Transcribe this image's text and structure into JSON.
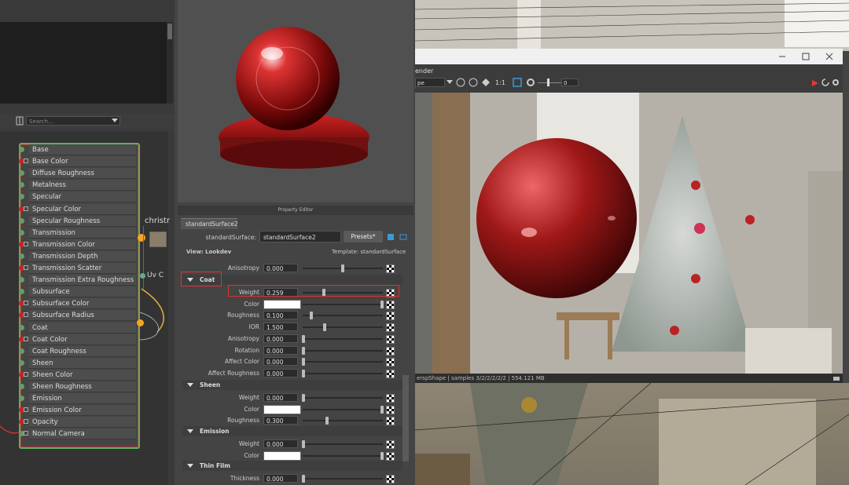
{
  "colors": {
    "accent_red": "#dd3333",
    "port_green": "#6a9a6a",
    "port_red": "#cc2222",
    "node_border": "#5fae5f",
    "orange": "#f5a623"
  },
  "node_editor": {
    "search_placeholder": "Search...",
    "attributes": [
      {
        "label": "Base",
        "port": "green",
        "expand": false
      },
      {
        "label": "Base Color",
        "port": "red",
        "expand": true
      },
      {
        "label": "Diffuse Roughness",
        "port": "green",
        "expand": false
      },
      {
        "label": "Metalness",
        "port": "green",
        "expand": false
      },
      {
        "label": "Specular",
        "port": "green",
        "expand": false
      },
      {
        "label": "Specular Color",
        "port": "red",
        "expand": true
      },
      {
        "label": "Specular Roughness",
        "port": "green",
        "expand": false
      },
      {
        "label": "Transmission",
        "port": "green",
        "expand": false
      },
      {
        "label": "Transmission Color",
        "port": "red",
        "expand": true
      },
      {
        "label": "Transmission Depth",
        "port": "green",
        "expand": false
      },
      {
        "label": "Transmission Scatter",
        "port": "red",
        "expand": true
      },
      {
        "label": "Transmission Extra Roughness",
        "port": "green",
        "expand": false
      },
      {
        "label": "Subsurface",
        "port": "green",
        "expand": false
      },
      {
        "label": "Subsurface Color",
        "port": "red",
        "expand": true
      },
      {
        "label": "Subsurface Radius",
        "port": "red",
        "expand": true
      },
      {
        "label": "Coat",
        "port": "green",
        "expand": false
      },
      {
        "label": "Coat Color",
        "port": "red",
        "expand": true
      },
      {
        "label": "Coat Roughness",
        "port": "green",
        "expand": false
      },
      {
        "label": "Sheen",
        "port": "green",
        "expand": false
      },
      {
        "label": "Sheen Color",
        "port": "red",
        "expand": true
      },
      {
        "label": "Sheen Roughness",
        "port": "green",
        "expand": false
      },
      {
        "label": "Emission",
        "port": "green",
        "expand": false
      },
      {
        "label": "Emission Color",
        "port": "red",
        "expand": true
      },
      {
        "label": "Opacity",
        "port": "red",
        "expand": true
      },
      {
        "label": "Normal Camera",
        "port": "green",
        "expand": true
      }
    ],
    "side_node": {
      "title": "christr",
      "uv_label": "Uv C"
    }
  },
  "property_editor": {
    "title": "Property Editor",
    "tab": "standardSurface2",
    "type_label": "standardSurface:",
    "node_name": "standardSurface2",
    "presets_label": "Presets*",
    "view_label": "View: Lookdev",
    "template_label": "Template: standardSurface",
    "anisotropy_top": {
      "label": "Anisotropy",
      "value": "0.000",
      "level": 0.5
    },
    "sections": [
      {
        "title": "Coat",
        "rows": [
          {
            "label": "Weight",
            "type": "num",
            "value": "0.259",
            "level": 0.259
          },
          {
            "label": "Color",
            "type": "color",
            "value": "#ffffff",
            "level": 1.0
          },
          {
            "label": "Roughness",
            "type": "num",
            "value": "0.100",
            "level": 0.1
          },
          {
            "label": "IOR",
            "type": "num",
            "value": "1.500",
            "level": 0.27
          },
          {
            "label": "Anisotropy",
            "type": "num",
            "value": "0.000",
            "level": 0.0
          },
          {
            "label": "Rotation",
            "type": "num",
            "value": "0.000",
            "level": 0.0
          },
          {
            "label": "Affect Color",
            "type": "num",
            "value": "0.000",
            "level": 0.0
          },
          {
            "label": "Affect Roughness",
            "type": "num",
            "value": "0.000",
            "level": 0.0
          }
        ]
      },
      {
        "title": "Sheen",
        "rows": [
          {
            "label": "Weight",
            "type": "num",
            "value": "0.000",
            "level": 0.0
          },
          {
            "label": "Color",
            "type": "color",
            "value": "#ffffff",
            "level": 1.0
          },
          {
            "label": "Roughness",
            "type": "num",
            "value": "0.300",
            "level": 0.3
          }
        ]
      },
      {
        "title": "Emission",
        "rows": [
          {
            "label": "Weight",
            "type": "num",
            "value": "0.000",
            "level": 0.0
          },
          {
            "label": "Color",
            "type": "color",
            "value": "#ffffff",
            "level": 1.0
          }
        ]
      },
      {
        "title": "Thin Film",
        "rows": [
          {
            "label": "Thickness",
            "type": "num",
            "value": "0.000",
            "level": 0.0
          }
        ]
      }
    ]
  },
  "render_view": {
    "title": "ender",
    "camera_label": "pe",
    "ratio_label": "1:1",
    "exposure_value": "0",
    "status_text": "erspShape  |  samples 3/2/2/2/2/2  |  554.121 MB"
  }
}
